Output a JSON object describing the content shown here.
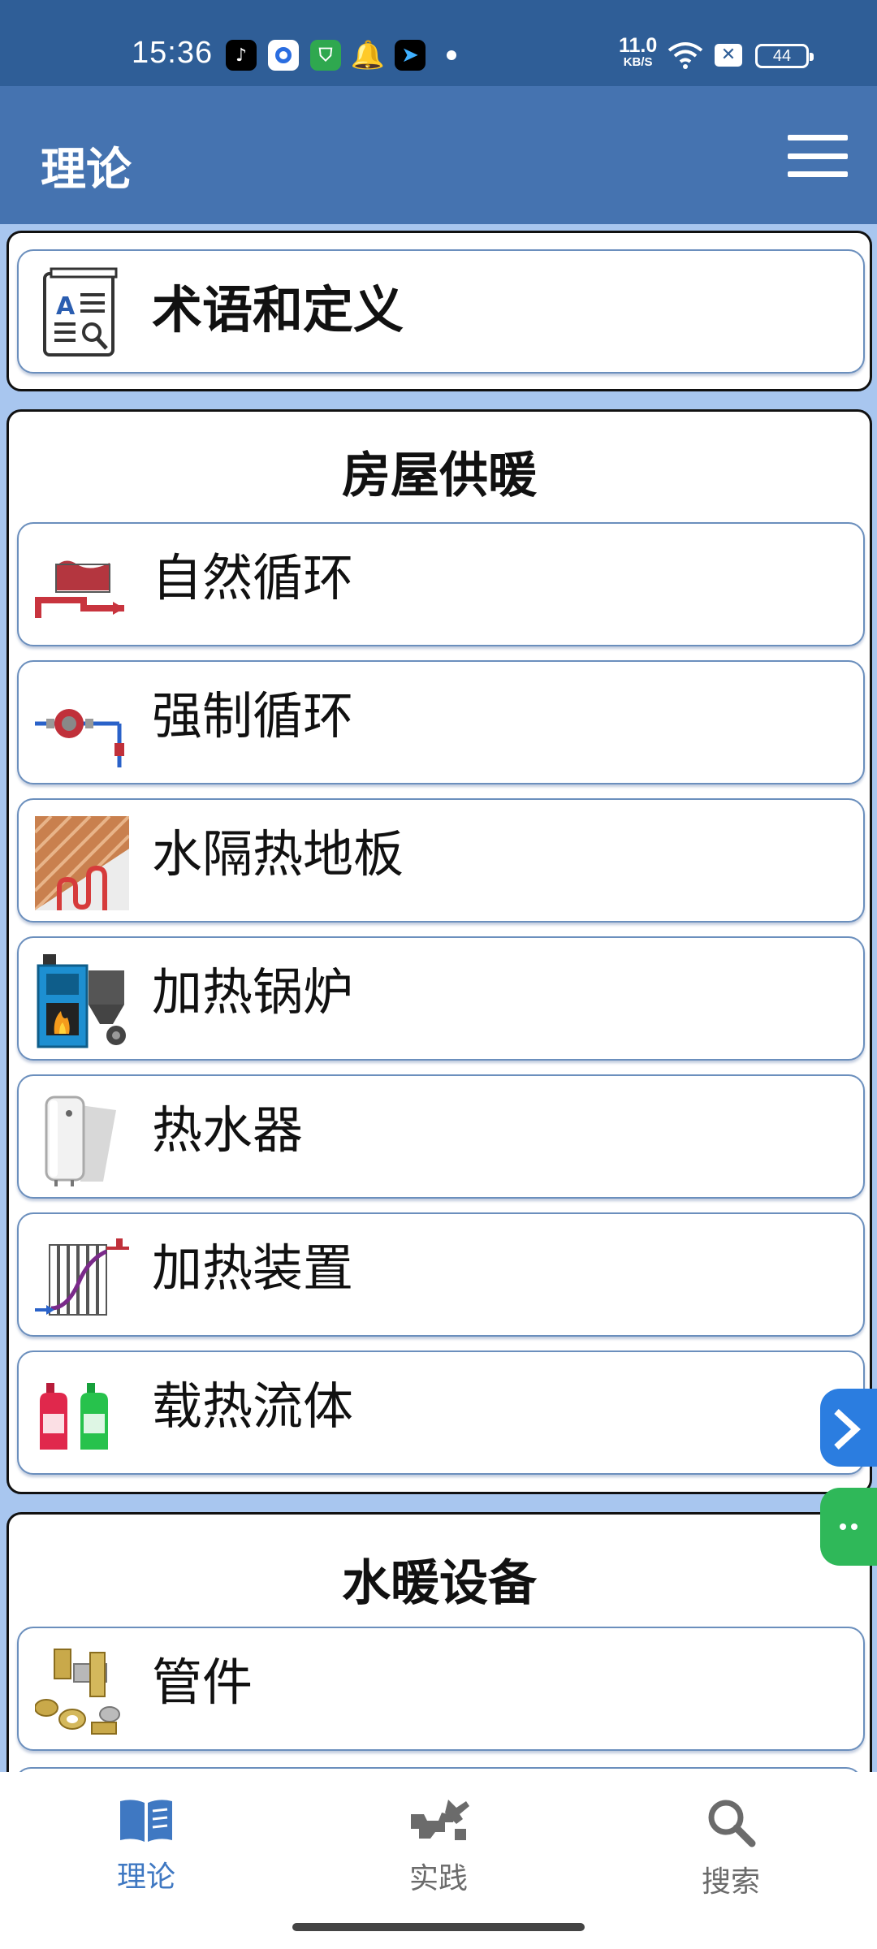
{
  "status_bar": {
    "time": "15:36",
    "net_speed_value": "11.0",
    "net_speed_unit": "KB/S",
    "battery": "44",
    "notification_icons": [
      "tiktok-icon",
      "browser-icon",
      "security-icon",
      "qq-icon",
      "send-icon"
    ]
  },
  "app_bar": {
    "title": "理论"
  },
  "terms_card": {
    "label": "术语和定义",
    "icon": "glossary-book-icon"
  },
  "section_heating": {
    "title": "房屋供暖",
    "items": [
      {
        "label": "自然循环",
        "icon": "natural-circulation-icon"
      },
      {
        "label": "强制循环",
        "icon": "circulation-pump-icon"
      },
      {
        "label": "水隔热地板",
        "icon": "underfloor-heating-icon"
      },
      {
        "label": "加热锅炉",
        "icon": "boiler-icon"
      },
      {
        "label": "热水器",
        "icon": "water-heater-icon"
      },
      {
        "label": "加热装置",
        "icon": "radiator-icon"
      },
      {
        "label": "载热流体",
        "icon": "coolant-bottles-icon"
      }
    ]
  },
  "section_plumbing": {
    "title": "水暖设备",
    "items": [
      {
        "label": "管件",
        "icon": "pipe-fittings-icon"
      }
    ]
  },
  "bottom_nav": {
    "items": [
      {
        "label": "理论",
        "icon": "book-icon",
        "active": true
      },
      {
        "label": "实践",
        "icon": "tools-icon",
        "active": false
      },
      {
        "label": "搜索",
        "icon": "search-icon",
        "active": false
      }
    ]
  },
  "colors": {
    "status_bar": "#2f5e97",
    "app_bar": "#4573b0",
    "content_bg": "#a8c6ef",
    "item_border": "#6b8fbd",
    "nav_active": "#3f78c2",
    "nav_inactive": "#6b6b6b"
  }
}
